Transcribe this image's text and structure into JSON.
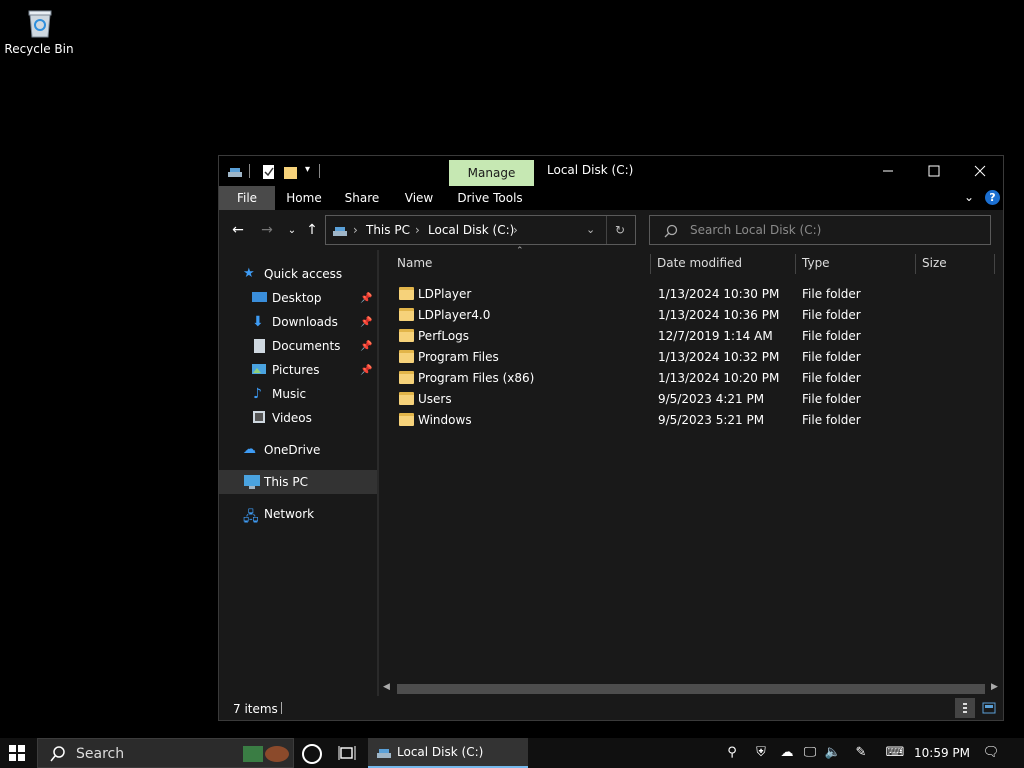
{
  "desktop": {
    "recycle_bin_label": "Recycle Bin"
  },
  "window": {
    "title": "Local Disk (C:)",
    "contextual_tab": "Manage",
    "ribbon_tabs": [
      "File",
      "Home",
      "Share",
      "View",
      "Drive Tools"
    ]
  },
  "address": {
    "segments": [
      "This PC",
      "Local Disk (C:)"
    ],
    "search_placeholder": "Search Local Disk (C:)"
  },
  "nav_pane": {
    "quick_access": "Quick access",
    "quick_items": [
      "Desktop",
      "Downloads",
      "Documents",
      "Pictures",
      "Music",
      "Videos"
    ],
    "onedrive": "OneDrive",
    "this_pc": "This PC",
    "network": "Network"
  },
  "columns": {
    "name": "Name",
    "date": "Date modified",
    "type": "Type",
    "size": "Size"
  },
  "files": [
    {
      "name": "LDPlayer",
      "date": "1/13/2024 10:30 PM",
      "type": "File folder"
    },
    {
      "name": "LDPlayer4.0",
      "date": "1/13/2024 10:36 PM",
      "type": "File folder"
    },
    {
      "name": "PerfLogs",
      "date": "12/7/2019 1:14 AM",
      "type": "File folder"
    },
    {
      "name": "Program Files",
      "date": "1/13/2024 10:32 PM",
      "type": "File folder"
    },
    {
      "name": "Program Files (x86)",
      "date": "1/13/2024 10:20 PM",
      "type": "File folder"
    },
    {
      "name": "Users",
      "date": "9/5/2023 4:21 PM",
      "type": "File folder"
    },
    {
      "name": "Windows",
      "date": "9/5/2023 5:21 PM",
      "type": "File folder"
    }
  ],
  "status": {
    "items_count": "7 items"
  },
  "taskbar": {
    "search_label": "Search",
    "open_app": "Local Disk (C:)",
    "clock": "10:59 PM"
  },
  "colors": {
    "manage_tab": "#c6e8b3",
    "folder": "#f6d27a",
    "selected": "#333333"
  }
}
